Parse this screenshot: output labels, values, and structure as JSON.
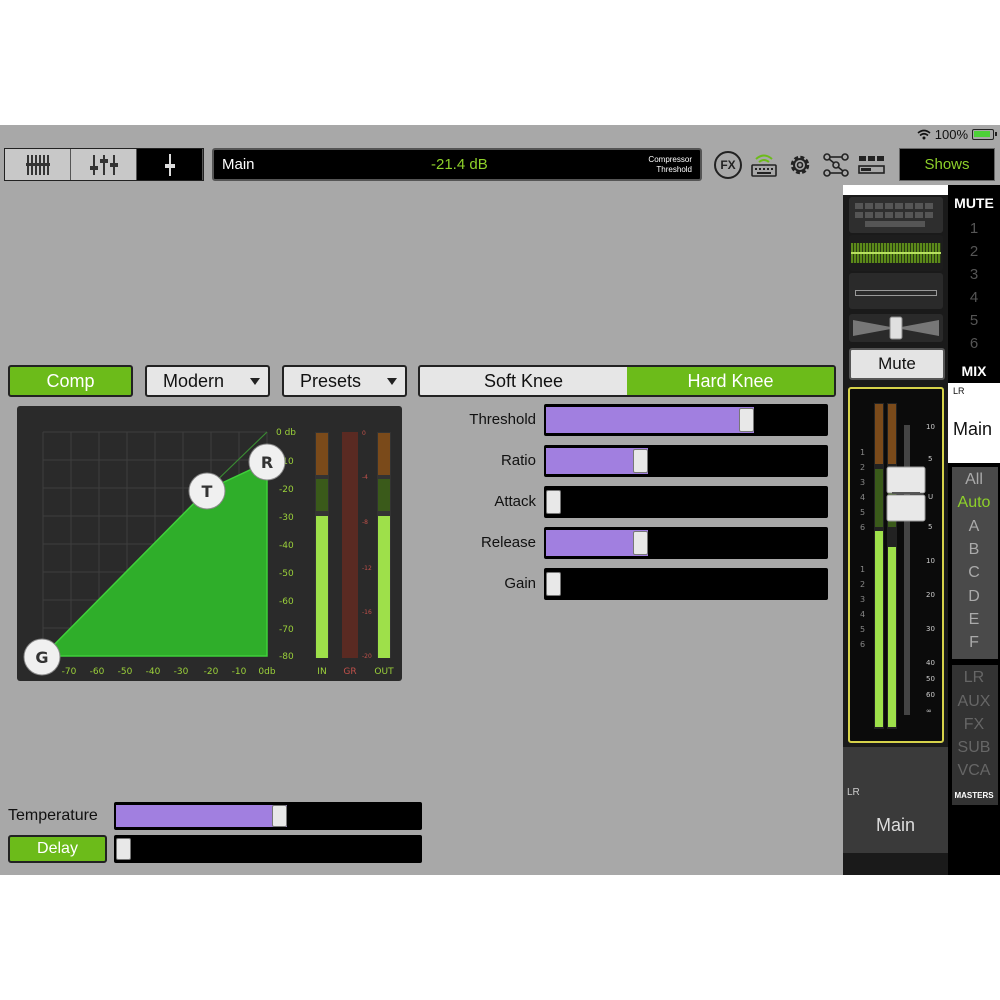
{
  "status": {
    "battery": "100%"
  },
  "header": {
    "channel_name": "Main",
    "value": "-21.4 dB",
    "parameter_line1": "Compressor",
    "parameter_line2": "Threshold",
    "fx_label": "FX",
    "shows_label": "Shows"
  },
  "controls": {
    "comp_label": "Comp",
    "mode_label": "Modern",
    "presets_label": "Presets",
    "soft_knee": "Soft Knee",
    "hard_knee": "Hard Knee"
  },
  "graph": {
    "top_label": "0 db",
    "y_ticks": [
      "-10",
      "-20",
      "-30",
      "-40",
      "-50",
      "-60",
      "-70",
      "-80"
    ],
    "x_ticks": [
      "-70",
      "-60",
      "-50",
      "-40",
      "-30",
      "-20",
      "-10",
      "0db"
    ],
    "node_g": "G",
    "node_t": "T",
    "node_r": "R",
    "meter_in": "IN",
    "meter_gr": "GR",
    "meter_out": "OUT"
  },
  "params": [
    {
      "label": "Threshold",
      "value": 0.73
    },
    {
      "label": "Ratio",
      "value": 0.33
    },
    {
      "label": "Attack",
      "value": 0.0
    },
    {
      "label": "Release",
      "value": 0.33
    },
    {
      "label": "Gain",
      "value": 0.0
    }
  ],
  "bottom": {
    "temperature_label": "Temperature",
    "temperature_value": 0.54,
    "delay_label": "Delay",
    "delay_value": 0.0
  },
  "right": {
    "mute_header": "MUTE",
    "mute_groups": [
      "1",
      "2",
      "3",
      "4",
      "5",
      "6"
    ],
    "mute_button": "Mute",
    "mix_header": "MIX",
    "lr_small": "LR",
    "main_label": "Main",
    "view_filters": [
      "All",
      "Auto",
      "A",
      "B",
      "C",
      "D",
      "E",
      "F"
    ],
    "master_filters": [
      "LR",
      "AUX",
      "FX",
      "SUB",
      "VCA"
    ],
    "masters_label": "MASTERS",
    "strip_lr": "LR",
    "strip_name": "Main",
    "fader_scale": [
      "10",
      "5",
      "U",
      "5",
      "10",
      "20",
      "30",
      "40",
      "50",
      "60",
      "∞"
    ],
    "meter_scale_a": [
      "1",
      "2",
      "3",
      "4",
      "5",
      "6"
    ],
    "meter_scale_b": [
      "1",
      "2",
      "3",
      "4",
      "5",
      "6"
    ]
  },
  "colors": {
    "accent_green": "#6cbb1a",
    "value_green": "#8ed12a",
    "slider_purple": "#a17fe0",
    "selected_yellow": "#d6d24a"
  }
}
